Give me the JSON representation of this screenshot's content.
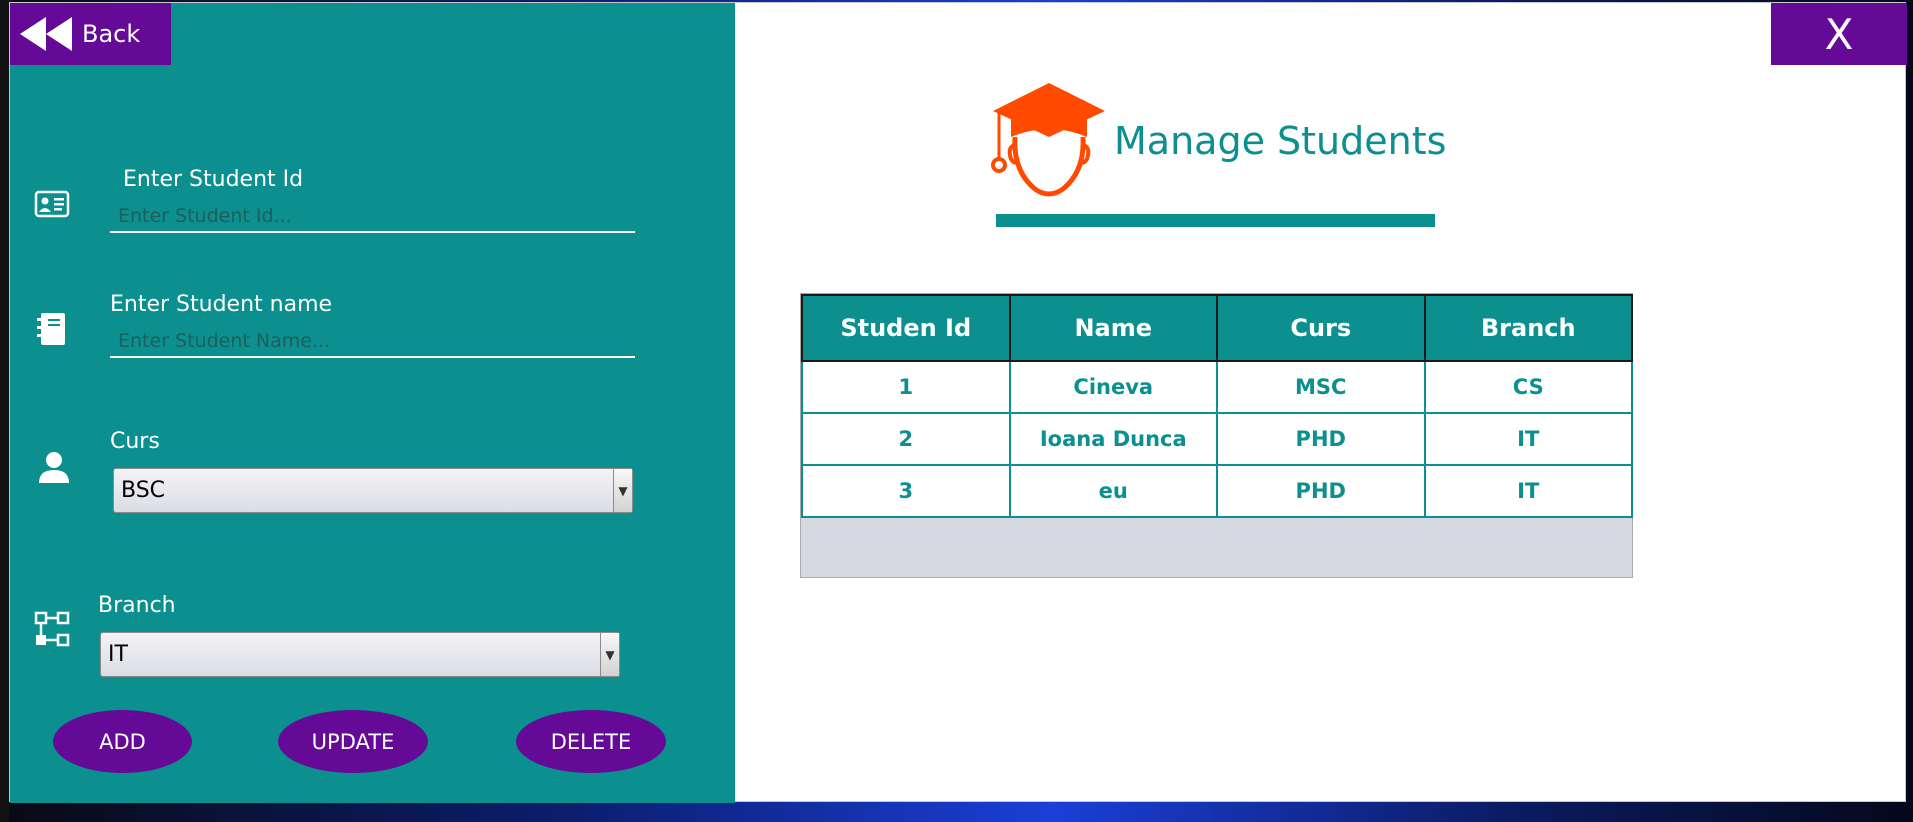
{
  "nav": {
    "back_label": "Back",
    "close_label": "X"
  },
  "header": {
    "title": "Manage Students"
  },
  "form": {
    "student_id": {
      "label": "Enter Student Id",
      "placeholder": "Enter Student Id...",
      "value": ""
    },
    "student_name": {
      "label": "Enter Student name",
      "placeholder": "Enter Student Name...",
      "value": ""
    },
    "curs": {
      "label": "Curs",
      "selected": "BSC"
    },
    "branch": {
      "label": "Branch",
      "selected": "IT"
    }
  },
  "buttons": {
    "add": "ADD",
    "update": "UPDATE",
    "delete": "DELETE"
  },
  "table": {
    "headers": [
      "Studen Id",
      "Name",
      "Curs",
      "Branch"
    ],
    "rows": [
      [
        "1",
        "Cineva",
        "MSC",
        "CS"
      ],
      [
        "2",
        "Ioana Dunca",
        "PHD",
        "IT"
      ],
      [
        "3",
        "eu",
        "PHD",
        "IT"
      ]
    ]
  },
  "colors": {
    "teal": "#0b8f8f",
    "purple": "#650a96",
    "logo_orange": "#ff4a00"
  },
  "icons": [
    "rewind-icon",
    "id-card-icon",
    "notebook-icon",
    "user-icon",
    "branch-icon",
    "student-graduate-icon"
  ]
}
